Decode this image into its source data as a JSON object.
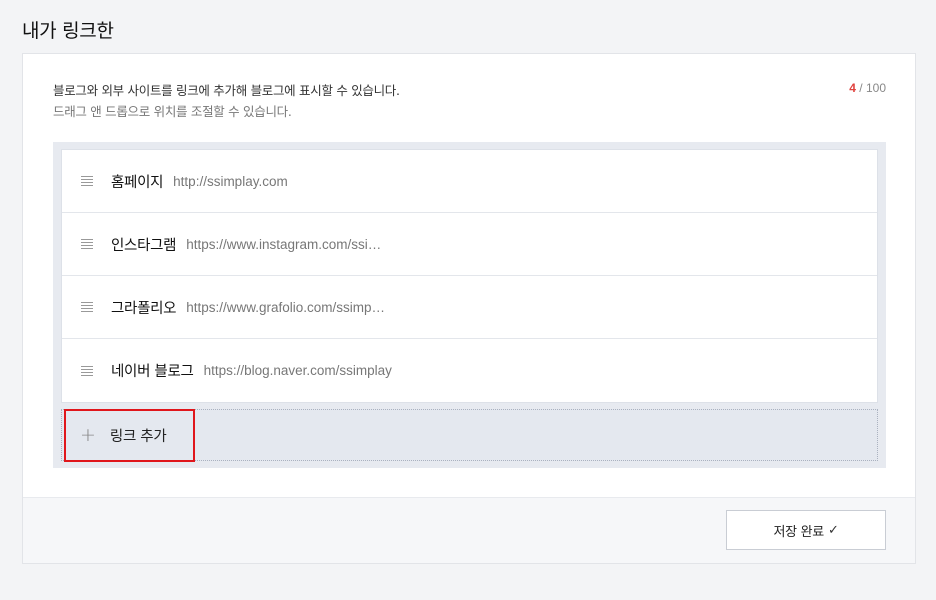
{
  "page_title": "내가 링크한",
  "description": {
    "line1": "블로그와 외부 사이트를 링크에 추가해 블로그에 표시할 수 있습니다.",
    "line2": "드래그 앤 드롭으로 위치를 조절할 수 있습니다."
  },
  "counter": {
    "current": "4",
    "max": "/ 100"
  },
  "links": [
    {
      "name": "홈페이지",
      "url": "http://ssimplay.com"
    },
    {
      "name": "인스타그램",
      "url": "https://www.instagram.com/ssi…"
    },
    {
      "name": "그라폴리오",
      "url": "https://www.grafolio.com/ssimp…"
    },
    {
      "name": "네이버 블로그",
      "url": "https://blog.naver.com/ssimplay"
    }
  ],
  "add_link": {
    "icon": "plus-icon",
    "label": "링크 추가"
  },
  "footer": {
    "save_label": "저장 완료",
    "save_icon": "check-icon"
  },
  "colors": {
    "highlight": "#e0161b",
    "counter_accent": "#e0413d"
  }
}
